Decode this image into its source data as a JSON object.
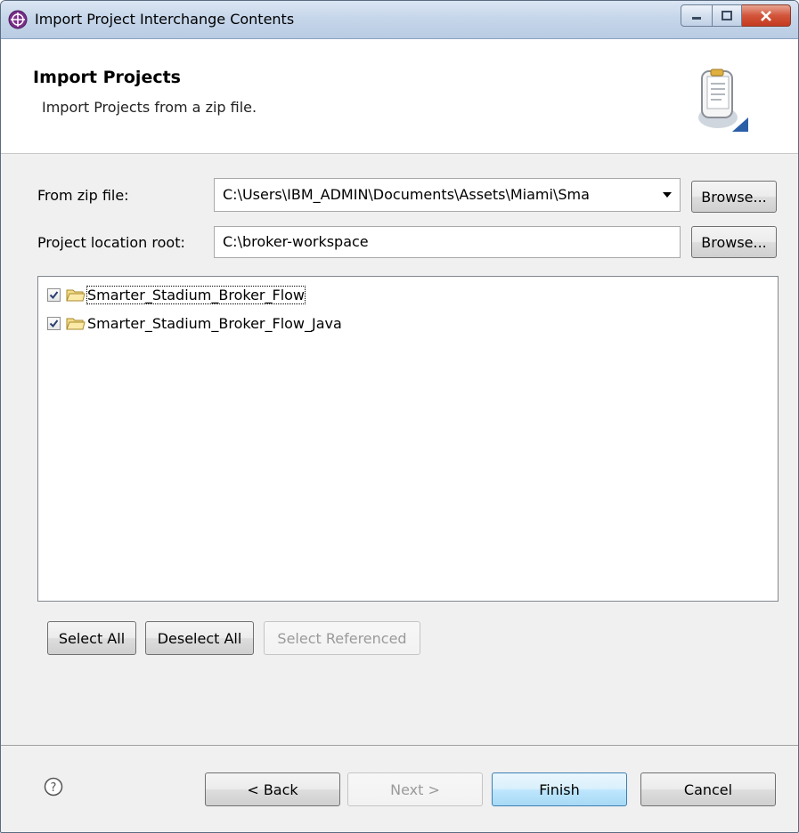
{
  "window": {
    "title": "Import Project Interchange Contents"
  },
  "header": {
    "title": "Import Projects",
    "description": "Import Projects from a zip file."
  },
  "form": {
    "zip_label": "From zip file:",
    "zip_value": "C:\\Users\\IBM_ADMIN\\Documents\\Assets\\Miami\\Sma",
    "zip_browse": "Browse...",
    "root_label": "Project location root:",
    "root_value": "C:\\broker-workspace",
    "root_browse": "Browse..."
  },
  "projects": [
    {
      "name": "Smarter_Stadium_Broker_Flow",
      "checked": true
    },
    {
      "name": "Smarter_Stadium_Broker_Flow_Java",
      "checked": true
    }
  ],
  "selection_buttons": {
    "select_all": "Select All",
    "deselect_all": "Deselect All",
    "select_referenced": "Select Referenced"
  },
  "footer": {
    "back": "< Back",
    "next": "Next >",
    "finish": "Finish",
    "cancel": "Cancel"
  },
  "icons": {
    "app": "import-globe-icon",
    "wizard": "wizard-page-icon",
    "help": "help-icon",
    "folder": "folder-icon"
  },
  "colors": {
    "titlebar": "#c6d6ea",
    "close_button": "#c43a20",
    "default_button_border": "#3c7fb1"
  }
}
